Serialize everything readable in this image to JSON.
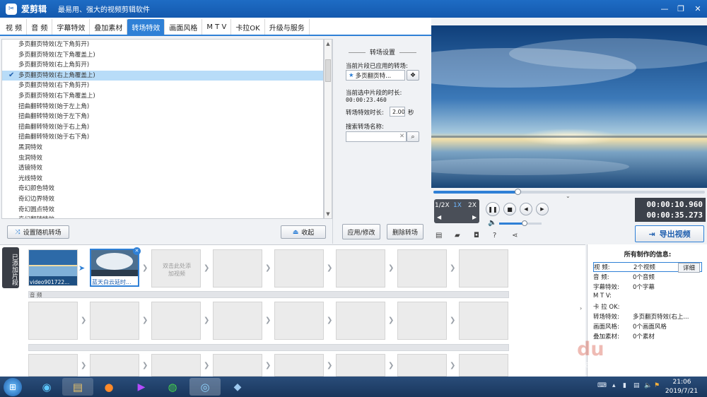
{
  "titlebar": {
    "app_name": "爱剪辑",
    "slogan": "最易用、强大的视频剪辑软件",
    "minimize": "—",
    "restore": "❐",
    "close": "✕"
  },
  "tabs": [
    {
      "label": "视  频",
      "active": false
    },
    {
      "label": "音  频",
      "active": false
    },
    {
      "label": "字幕特效",
      "active": false
    },
    {
      "label": "叠加素材",
      "active": false
    },
    {
      "label": "转场特效",
      "active": true
    },
    {
      "label": "画面风格",
      "active": false
    },
    {
      "label": "M T V",
      "active": false
    },
    {
      "label": "卡拉OK",
      "active": false
    },
    {
      "label": "升级与服务",
      "active": false
    }
  ],
  "effect_list": [
    {
      "label": "多页翻页特效(左下角剪开)",
      "selected": false
    },
    {
      "label": "多页翻页特效(左下角覆盖上)",
      "selected": false
    },
    {
      "label": "多页翻页特效(右上角剪开)",
      "selected": false
    },
    {
      "label": "多页翻页特效(右上角覆盖上)",
      "selected": true
    },
    {
      "label": "多页翻页特效(右下角剪开)",
      "selected": false
    },
    {
      "label": "多页翻页特效(右下角覆盖上)",
      "selected": false
    },
    {
      "label": "扭曲翻转特效(始于左上角)",
      "selected": false
    },
    {
      "label": "扭曲翻转特效(始于左下角)",
      "selected": false
    },
    {
      "label": "扭曲翻转特效(始于右上角)",
      "selected": false
    },
    {
      "label": "扭曲翻转特效(始于右下角)",
      "selected": false
    },
    {
      "label": "黑洞特效",
      "selected": false
    },
    {
      "label": "虫洞特效",
      "selected": false
    },
    {
      "label": "透镜特效",
      "selected": false
    },
    {
      "label": "光线特效",
      "selected": false
    },
    {
      "label": "奇幻颜色特效",
      "selected": false
    },
    {
      "label": "奇幻边界特效",
      "selected": false
    },
    {
      "label": "奇幻圆点特效",
      "selected": false
    },
    {
      "label": "奇幻翻转特效",
      "selected": false
    }
  ],
  "list_buttons": {
    "random": "设置随机转场",
    "collapse": "收起"
  },
  "settings": {
    "title": "转场设置",
    "applied_label": "当前片段已应用的转场:",
    "applied_value": "多页翻页特...",
    "duration_label": "当前选中片段的时长:",
    "duration_value": "00:00:23.460",
    "effect_duration_label": "转场特效时长:",
    "effect_duration_value": "2.00",
    "effect_duration_unit": "秒",
    "search_label": "搜索转场名称:",
    "search_value": "",
    "apply_button": "应用/修改",
    "delete_button": "删除转场"
  },
  "player": {
    "speeds": [
      "1/2X",
      "1X",
      "2X"
    ],
    "active_speed": "1X",
    "progress": 0.31,
    "volume": 0.6,
    "current_time": "00:00:10.960",
    "total_time": "00:00:35.273",
    "export_button": "导出视频"
  },
  "timeline": {
    "side_tab": "已添加片段",
    "clips": [
      {
        "label": "video901722...",
        "selected": false
      },
      {
        "label": "蓝天白云延时...",
        "selected": true
      }
    ],
    "empty_slot_text": "双击此处添加视频",
    "audio_label": "音 频"
  },
  "info": {
    "title": "所有制作的信息:",
    "rows": [
      {
        "key": "视    频:",
        "value": "2个视频",
        "detail": "详细"
      },
      {
        "key": "音    频:",
        "value": "0个音频"
      },
      {
        "key": "字幕特效:",
        "value": "0个字幕"
      },
      {
        "key": "M  T  V:",
        "value": ""
      },
      {
        "key": "卡 拉 OK:",
        "value": ""
      },
      {
        "key": "转场特效:",
        "value": "多页翻页特效(右上..."
      },
      {
        "key": "画面风格:",
        "value": "0个画面风格"
      },
      {
        "key": "叠加素材:",
        "value": "0个素材"
      }
    ]
  },
  "taskbar": {
    "time": "21:06",
    "date": "2019/7/21"
  },
  "colors": {
    "accent": "#2f80d6",
    "titlebar": "#1a64be",
    "selected": "#b8dcf8"
  }
}
